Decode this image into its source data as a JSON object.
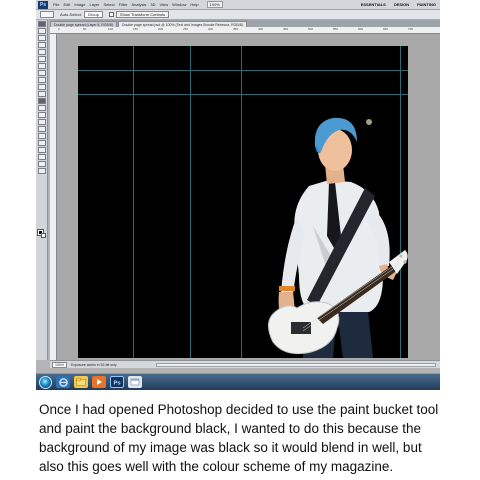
{
  "menubar": {
    "logo": "Ps",
    "items": [
      "File",
      "Edit",
      "Image",
      "Layer",
      "Select",
      "Filter",
      "Analysis",
      "3D",
      "View",
      "Window",
      "Help"
    ],
    "zoom": "100%",
    "workspaces": [
      "ESSENTIALS",
      "DESIGN",
      "PAINTING"
    ]
  },
  "options_bar": {
    "auto_select_label": "Auto-Select:",
    "auto_select_value": "Group",
    "transform_controls_label": "Show Transform Controls"
  },
  "document_tabs": [
    {
      "label": "Double page spread (Layer 8, RGB/8)",
      "active": false
    },
    {
      "label": "Double page spread.psd @ 100% (Text and Images Brooke Rebecca, RGB/8)",
      "active": true
    }
  ],
  "ruler": {
    "top_ticks": [
      "0",
      "50",
      "100",
      "150",
      "200",
      "250",
      "300",
      "350",
      "400",
      "450",
      "500",
      "550",
      "600",
      "650",
      "700"
    ]
  },
  "statusbar": {
    "zoom": "100%",
    "doc_info": "Exposure works in 32-bit only"
  },
  "taskbar": {
    "buttons": [
      "internet-explorer-icon",
      "folder-icon",
      "media-player-icon",
      "photoshop-icon",
      "explorer-icon"
    ]
  },
  "colors": {
    "canvas": "#000000",
    "guide": "#2d6b74",
    "taskbar": "#2a4a6d"
  },
  "caption": {
    "text": "Once I had opened Photoshop decided to use the paint bucket tool and paint the background black, I wanted to do this because the background of my image was black so it would blend in well, but also this goes well with the colour scheme of my magazine."
  }
}
